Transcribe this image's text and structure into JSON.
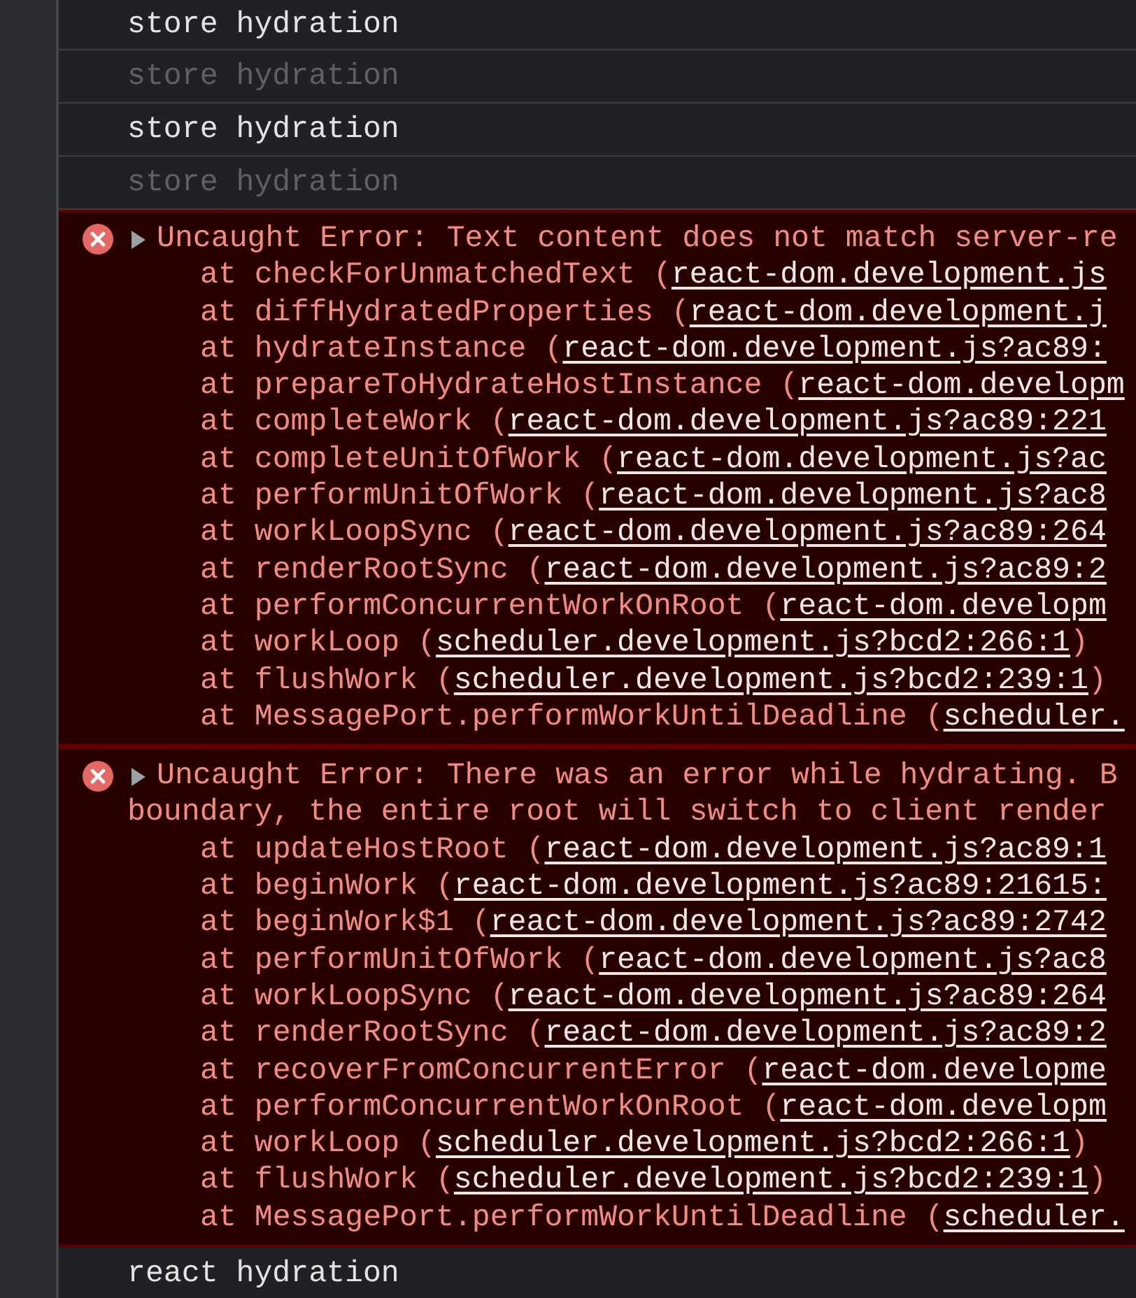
{
  "console": [
    {
      "kind": "log",
      "text": "store hydration",
      "dimmed": false
    },
    {
      "kind": "log",
      "text": "store hydration",
      "dimmed": true
    },
    {
      "kind": "log",
      "text": "store hydration",
      "dimmed": false
    },
    {
      "kind": "log",
      "text": "store hydration",
      "dimmed": true
    },
    {
      "kind": "error",
      "message_lines": [
        "Uncaught Error: Text content does not match server-re"
      ],
      "stack": [
        {
          "prefix": "at checkForUnmatchedText (",
          "link": "react-dom.development.js"
        },
        {
          "prefix": "at diffHydratedProperties (",
          "link": "react-dom.development.j"
        },
        {
          "prefix": "at hydrateInstance (",
          "link": "react-dom.development.js?ac89:"
        },
        {
          "prefix": "at prepareToHydrateHostInstance (",
          "link": "react-dom.developm"
        },
        {
          "prefix": "at completeWork (",
          "link": "react-dom.development.js?ac89:221"
        },
        {
          "prefix": "at completeUnitOfWork (",
          "link": "react-dom.development.js?ac"
        },
        {
          "prefix": "at performUnitOfWork (",
          "link": "react-dom.development.js?ac8"
        },
        {
          "prefix": "at workLoopSync (",
          "link": "react-dom.development.js?ac89:264"
        },
        {
          "prefix": "at renderRootSync (",
          "link": "react-dom.development.js?ac89:2"
        },
        {
          "prefix": "at performConcurrentWorkOnRoot (",
          "link": "react-dom.developm"
        },
        {
          "prefix": "at workLoop (",
          "link": "scheduler.development.js?bcd2:266:1",
          "suffix": ")"
        },
        {
          "prefix": "at flushWork (",
          "link": "scheduler.development.js?bcd2:239:1",
          "suffix": ")"
        },
        {
          "prefix": "at MessagePort.performWorkUntilDeadline (",
          "link": "scheduler."
        }
      ]
    },
    {
      "kind": "error",
      "message_lines": [
        "Uncaught Error: There was an error while hydrating. B",
        "boundary, the entire root will switch to client render"
      ],
      "stack": [
        {
          "prefix": "at updateHostRoot (",
          "link": "react-dom.development.js?ac89:1"
        },
        {
          "prefix": "at beginWork (",
          "link": "react-dom.development.js?ac89:21615:"
        },
        {
          "prefix": "at beginWork$1 (",
          "link": "react-dom.development.js?ac89:2742"
        },
        {
          "prefix": "at performUnitOfWork (",
          "link": "react-dom.development.js?ac8"
        },
        {
          "prefix": "at workLoopSync (",
          "link": "react-dom.development.js?ac89:264"
        },
        {
          "prefix": "at renderRootSync (",
          "link": "react-dom.development.js?ac89:2"
        },
        {
          "prefix": "at recoverFromConcurrentError (",
          "link": "react-dom.developme"
        },
        {
          "prefix": "at performConcurrentWorkOnRoot (",
          "link": "react-dom.developm"
        },
        {
          "prefix": "at workLoop (",
          "link": "scheduler.development.js?bcd2:266:1",
          "suffix": ")"
        },
        {
          "prefix": "at flushWork (",
          "link": "scheduler.development.js?bcd2:239:1",
          "suffix": ")"
        },
        {
          "prefix": "at MessagePort.performWorkUntilDeadline (",
          "link": "scheduler."
        }
      ]
    },
    {
      "kind": "log",
      "text": "react hydration",
      "dimmed": false
    }
  ]
}
